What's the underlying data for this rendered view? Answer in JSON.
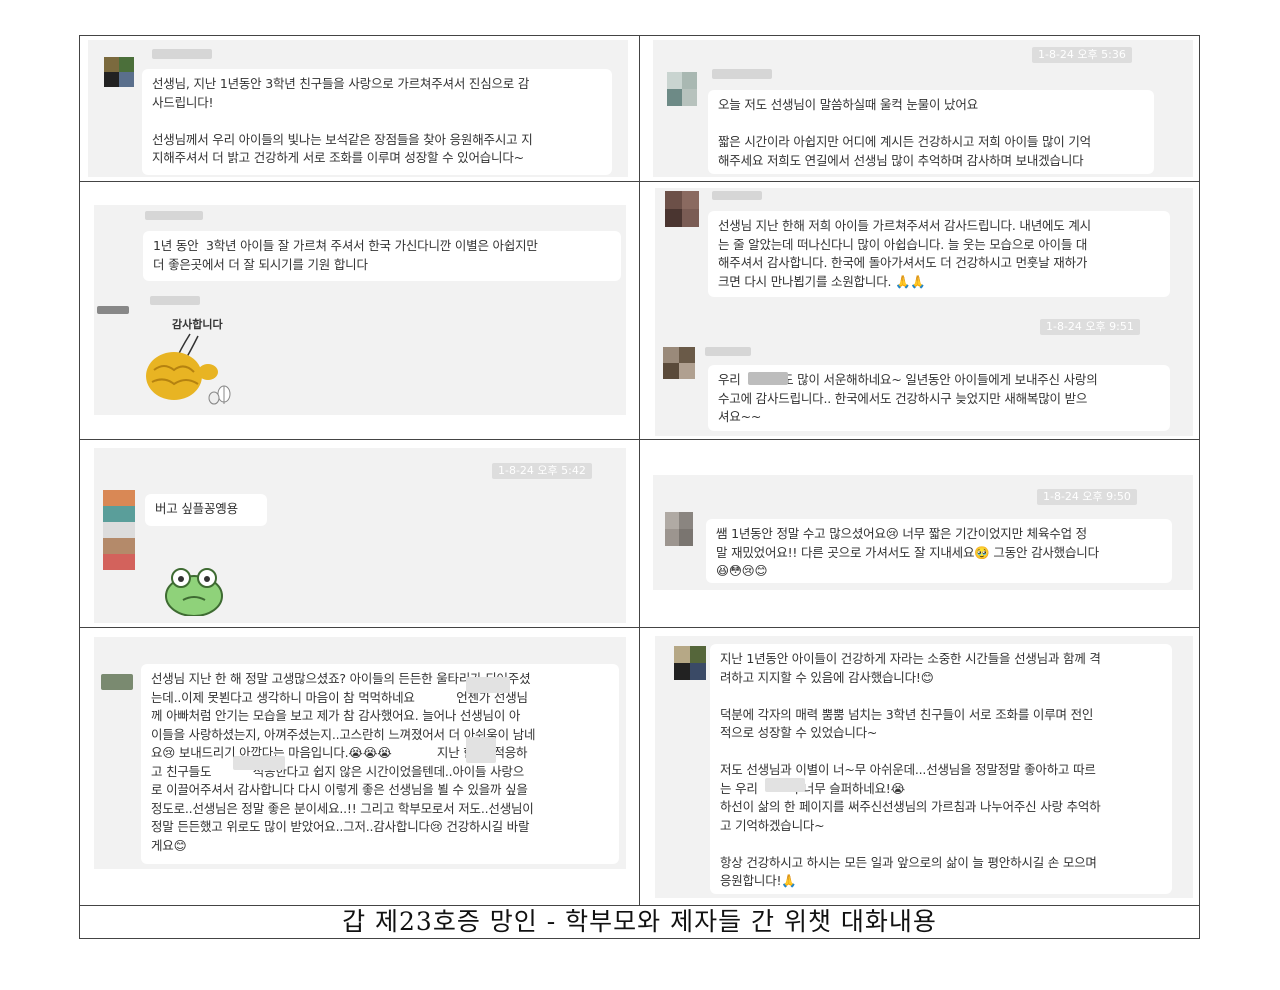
{
  "caption": "갑 제23호증 망인 - 학부모와 제자들 간 위챗 대화내용",
  "messages": {
    "m1": "선생님, 지난 1년동안 3학년 친구들을 사랑으로 가르쳐주셔서 진심으로 감\n사드립니다!\n\n선생님께서 우리 아이들의 빛나는 보석같은 장점들을 찾아 응원해주시고 지\n지해주셔서 더 밝고 건강하게 서로 조화를 이루며 성장할 수 있어습니다~",
    "m2_time": "1-8-24 오후 5:36",
    "m2": "오늘 저도 선생님이 말씀하실때 울컥 눈물이 났어요\n\n짧은 시간이라 아쉽지만 어디에 계시든 건강하시고 저희 아이들 많이 기억\n해주세요 저희도 연길에서 선생님 많이 추억하며 감사하며 보내겠습니다",
    "m3": "1년 동안  3학년 아이들 잘 가르쳐 주셔서 한국 가신다니깐 이별은 아쉽지만\n더 좋은곳에서 더 잘 되시기를 기원 합니다",
    "m3_sticker": "감사합니다",
    "m4": "선생님 지난 한해 저희 아이들 가르쳐주셔서 감사드립니다. 내년에도 계시\n는 줄 알았는데 떠나신다니 많이 아쉽습니다. 늘 웃는 모습으로 아이들 대\n해주셔서 감사합니다. 한국에 돌아가셔서도 더 건강하시고 먼훗날 재하가\n크면 다시 만나뵙기를 소원합니다. 🙏🙏",
    "m5_time": "1-8-24 오후 9:51",
    "m5": "우리           도 많이 서운해하네요~ 일년동안 아이들에게 보내주신 사랑의\n수고에 감사드립니다.. 한국에서도 건강하시구 늦었지만 새해복많이 받으\n셔요~~",
    "m6_time": "1-8-24 오후 5:42",
    "m6": "버고 싶플꽁옝용",
    "m7_time": "1-8-24 오후 9:50",
    "m7": "쌤 1년동안 정말 수고 많으셨어요😢 너무 짧은 기간이었지만 체육수업 정\n말 재밌었어요!! 다른 곳으로 가셔서도 잘 지내세요🥹 그동안 감사했습니다\n😆😳😢😊",
    "m8": "선생님 지난 한 해 정말 고생많으셨죠? 아이들의 든든한 울타리가 되어주셨\n는데..이제 못뵌다고 생각하니 마음이 참 먹먹하네요           언젠가 선생님\n께 아빠처럼 안기는 모습을 보고 제가 참 감사했어요. 늘어나 선생님이 아\n이들을 사랑하셨는지, 아껴주셨는지..고스란히 느껴졌어서 더 아쉬움이 남네\n요😢 보내드리기 아깝다는 마음입니다.😭😭😭            지난 한 해 적응하\n고 친구들도           적응한다고 쉽지 않은 시간이었을텐데..아이들 사랑으\n로 이끌어주셔서 감사합니다 다시 이렇게 좋은 선생님을 뵐 수 있을까 싶을\n정도로..선생님은 정말 좋은 분이세요..!! 그리고 학부모로서 저도..선생님이\n정말 든든했고 위로도 많이 받았어요..그저..감사합니다😢 건강하시길 바랄\n게요😊",
    "m9": "지난 1년동안 아이들이 건강하게 자라는 소중한 시간들을 선생님과 함께 격\n려하고 지지할 수 있음에 감사했습니다!😊\n\n덕분에 각자의 매력 뿜뿜 넘치는 3학년 친구들이 서로 조화를 이루며 전인\n적으로 성장할 수 있었습니다~\n\n저도 선생님과 이별이 너~무 아쉬운데...선생님을 정말정말 좋아하고 따르\n는 우리        가 너무 슬퍼하네요!😭\n하선이 삶의 한 페이지를 써주신선생님의 가르침과 나누어주신 사랑 추억하\n고 기억하겠습니다~\n\n항상 건강하시고 하시는 모든 일과 앞으로의 삶이 늘 평안하시길 손 모으며\n응원합니다!🙏"
  },
  "colors": {
    "frame": "#444444",
    "panel": "#f2f2f2",
    "bubble": "#ffffff",
    "timestamp_bg": "#dddddd"
  },
  "icons": {
    "sticker_bird": "gold-ballerina-bird-sticker",
    "sticker_frog": "crying-frog-sticker"
  }
}
